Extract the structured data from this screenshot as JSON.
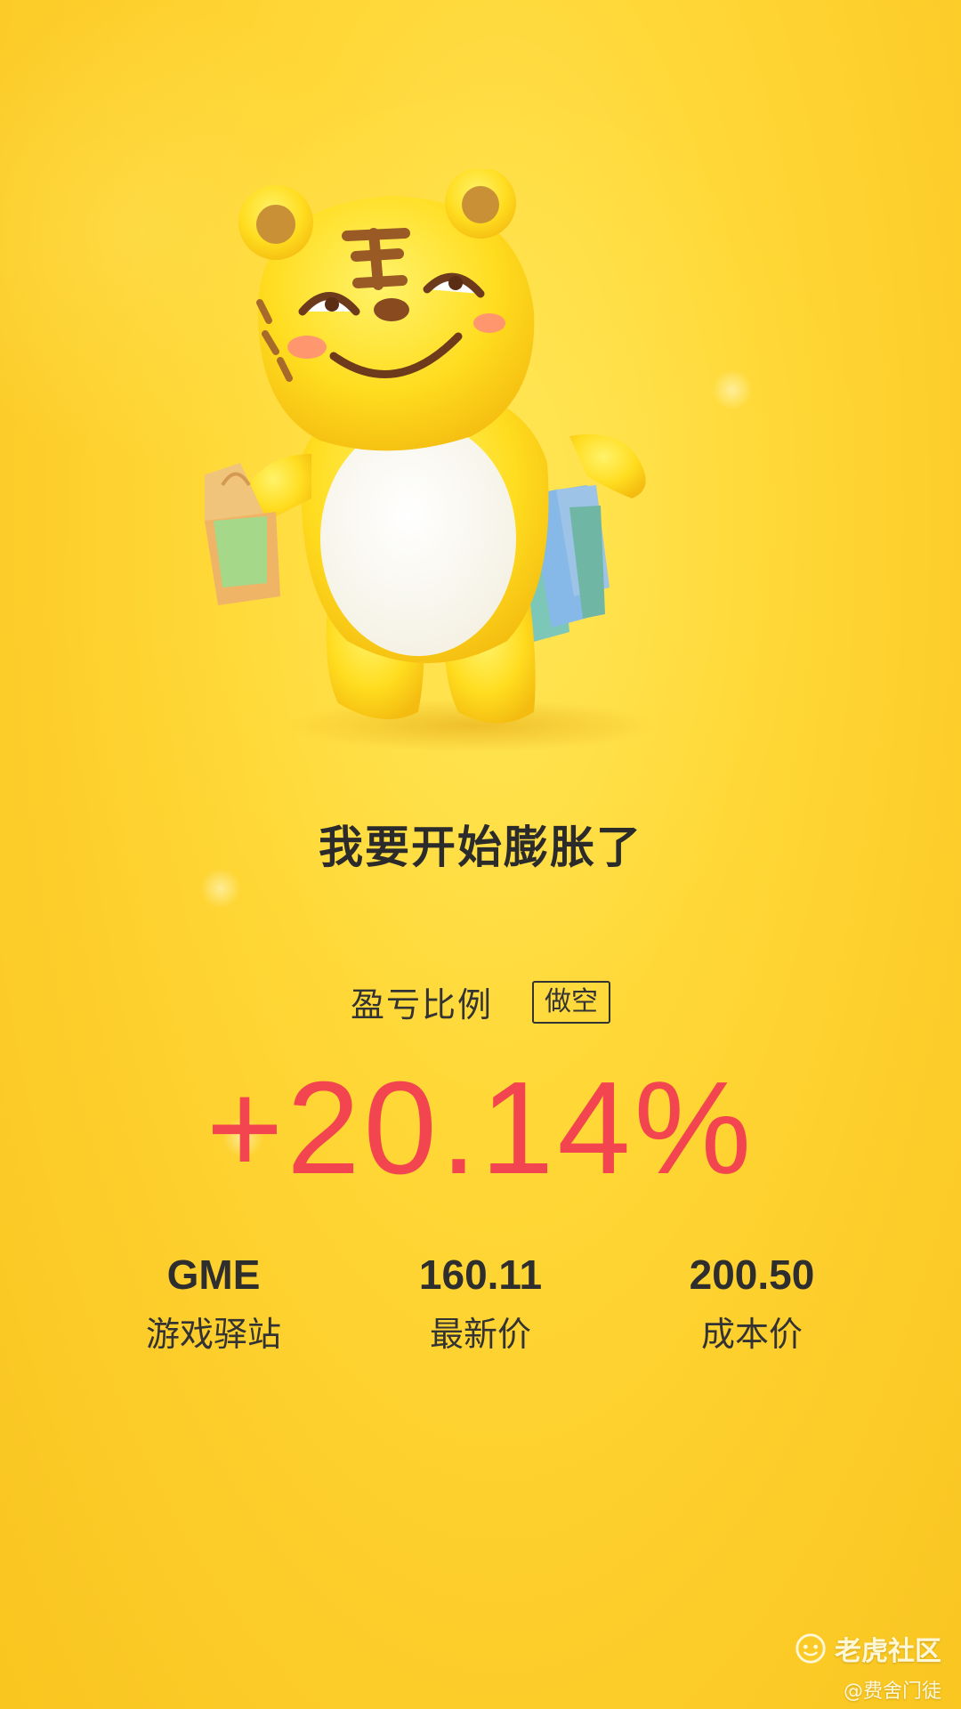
{
  "headline": "我要开始膨胀了",
  "pnl": {
    "label": "盈亏比例",
    "position_tag": "做空",
    "value": "+20.14%",
    "value_color": "#f2454f"
  },
  "stats": [
    {
      "value": "GME",
      "label": "游戏驿站"
    },
    {
      "value": "160.11",
      "label": "最新价"
    },
    {
      "value": "200.50",
      "label": "成本价"
    }
  ],
  "watermark": {
    "brand": "老虎社区",
    "user": "@费舍门徒"
  },
  "colors": {
    "background": "#fdcf2c",
    "text_dark": "#2b2b2b",
    "accent_red": "#f2454f"
  }
}
